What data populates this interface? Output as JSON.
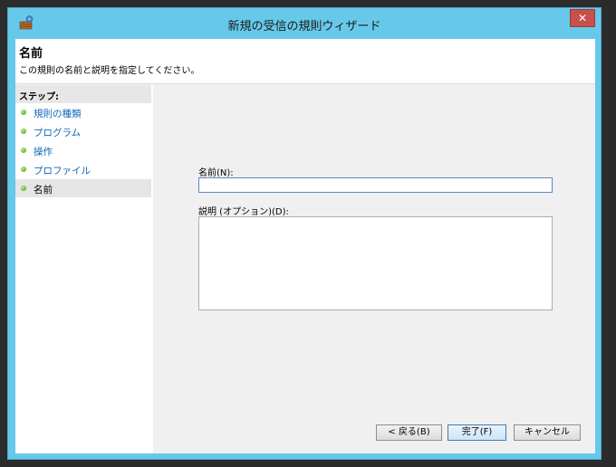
{
  "window": {
    "title": "新規の受信の規則ウィザード"
  },
  "header": {
    "title": "名前",
    "description": "この規則の名前と説明を指定してください。"
  },
  "sidebar": {
    "steps_label": "ステップ:",
    "items": [
      {
        "label": "規則の種類"
      },
      {
        "label": "プログラム"
      },
      {
        "label": "操作"
      },
      {
        "label": "プロファイル"
      },
      {
        "label": "名前",
        "active": true
      }
    ]
  },
  "form": {
    "name_label": "名前(N):",
    "name_value": "",
    "description_label": "説明 (オプション)(D):",
    "description_value": ""
  },
  "buttons": {
    "back": "< 戻る(B)",
    "finish": "完了(F)",
    "cancel": "キャンセル"
  },
  "colors": {
    "titlebar": "#66c9ea",
    "link": "#1166b7",
    "close": "#c7504b"
  }
}
